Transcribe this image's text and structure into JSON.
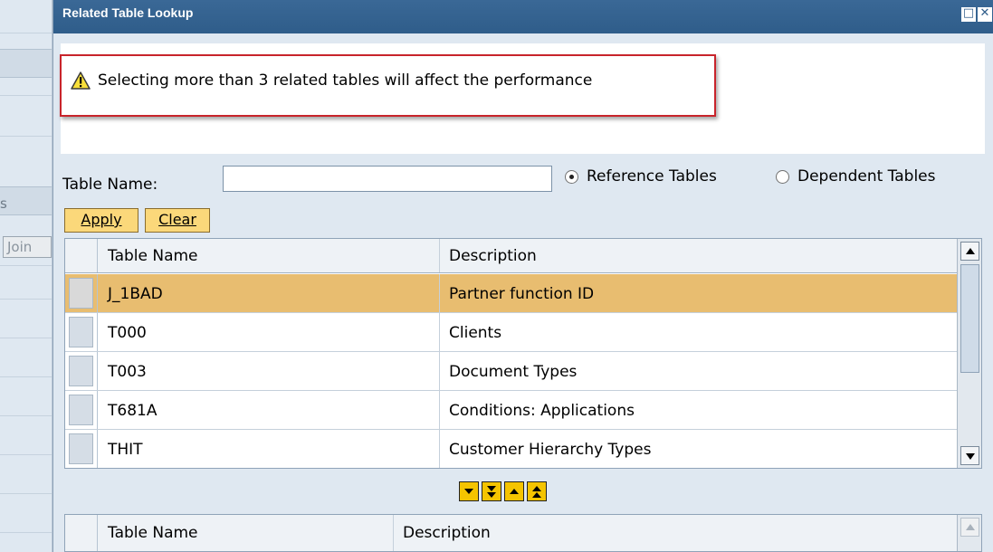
{
  "background": {
    "fragment_s": "s",
    "join_button": "Join"
  },
  "dialog": {
    "title": "Related Table Lookup",
    "maximize_glyph": "□",
    "close_glyph": "✕",
    "warning_icon": "warning-triangle-icon",
    "warning_message": "Selecting more than 3 related tables will affect the performance",
    "table_name_label": "Table Name:",
    "table_name_value": "",
    "radio_reference": "Reference Tables",
    "radio_dependent": "Dependent Tables",
    "radio_selected": "Reference Tables",
    "apply_label": "Apply",
    "clear_label": "Clear"
  },
  "results_table": {
    "columns": [
      "Table Name",
      "Description"
    ],
    "rows": [
      {
        "name": "J_1BAD",
        "description": "Partner function ID",
        "selected": true
      },
      {
        "name": "T000",
        "description": "Clients",
        "selected": false
      },
      {
        "name": "T003",
        "description": "Document Types",
        "selected": false
      },
      {
        "name": "T681A",
        "description": "Conditions: Applications",
        "selected": false
      },
      {
        "name": "THIT",
        "description": "Customer Hierarchy Types",
        "selected": false
      }
    ]
  },
  "move_buttons": [
    "move-down",
    "move-all-down",
    "move-up",
    "move-all-up"
  ],
  "selected_table": {
    "columns": [
      "Table Name",
      "Description"
    ]
  },
  "colors": {
    "title_bar": "#2f5d8a",
    "selected_row": "#e8bd70",
    "callout_border": "#c8242b",
    "button_yellow": "#fbd87a"
  }
}
